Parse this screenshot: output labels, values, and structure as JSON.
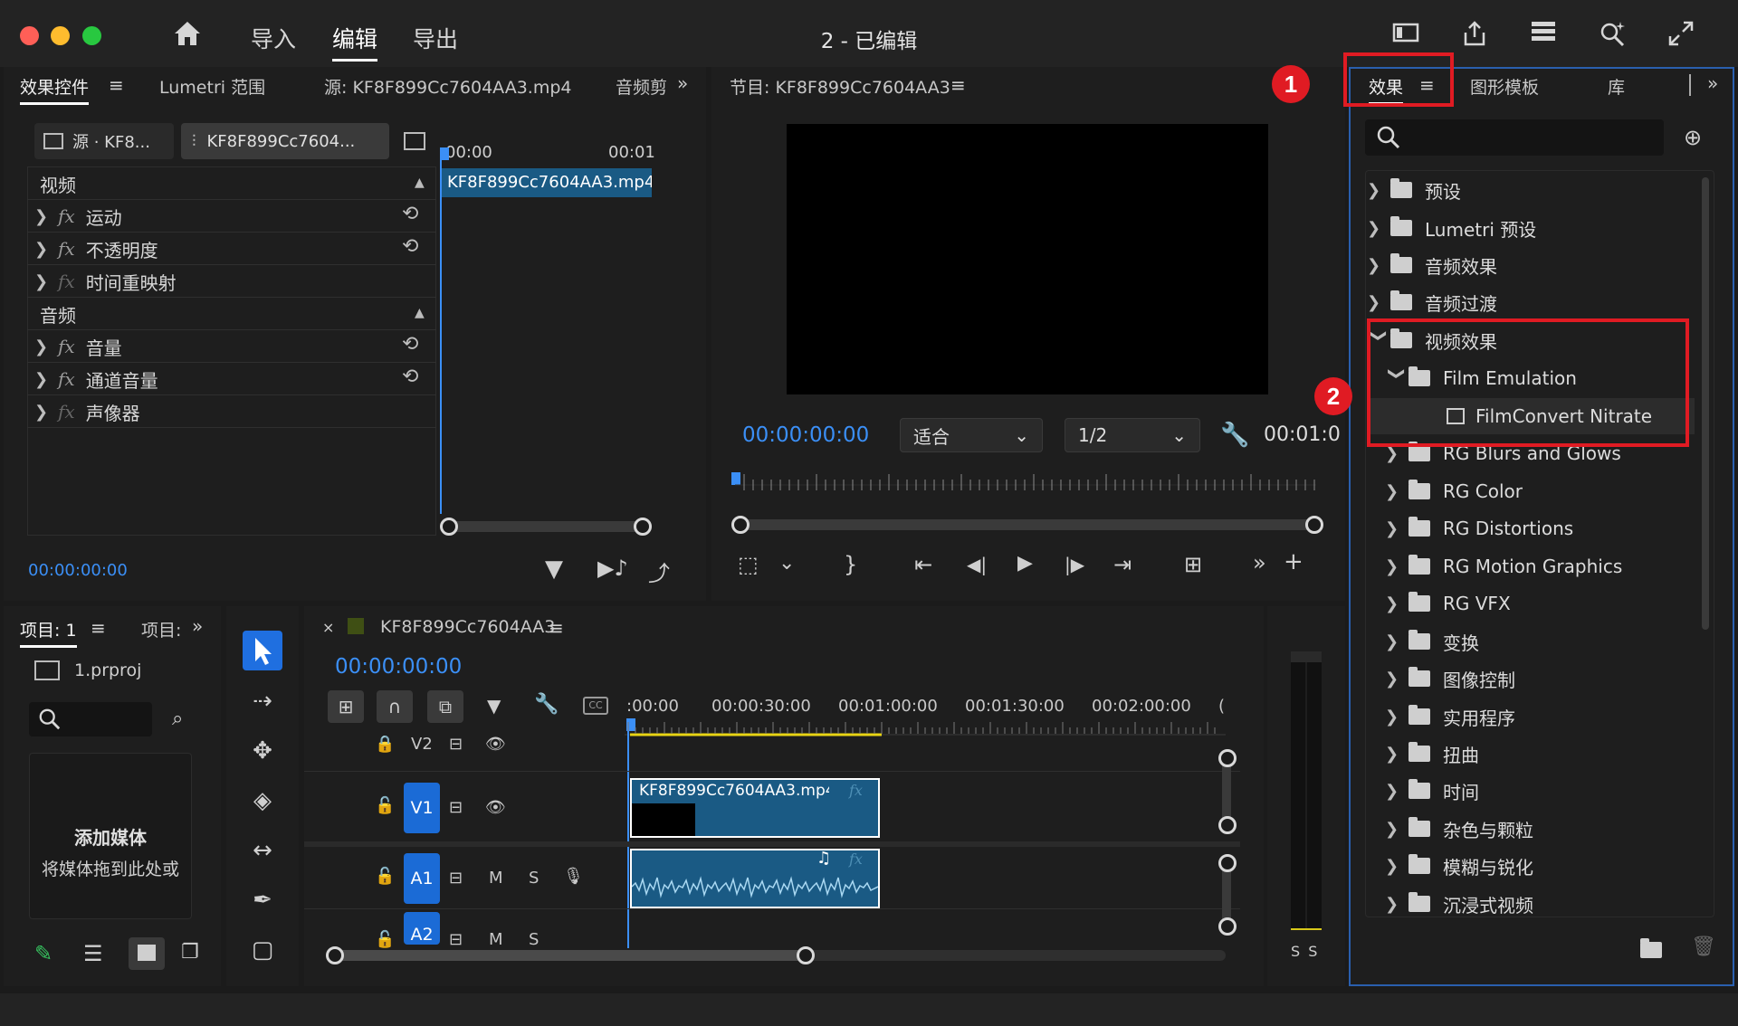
{
  "window": {
    "title": "2 - 已编辑"
  },
  "nav": {
    "import": "导入",
    "edit": "编辑",
    "export": "导出"
  },
  "effect_controls": {
    "tabs": [
      "效果控件",
      "Lumetri 范围",
      "源: KF8F899Cc7604AA3.mp4",
      "音频剪"
    ],
    "source_btn": "源 · KF8...",
    "seq_btn": "KF8F899Cc7604...",
    "time_start": "00:00",
    "time_end": "00:01",
    "clip_label": "KF8F899Cc7604AA3.mp4",
    "video_header": "视频",
    "audio_header": "音频",
    "video_rows": [
      "运动",
      "不透明度",
      "时间重映射"
    ],
    "audio_rows": [
      "音量",
      "通道音量",
      "声像器"
    ],
    "timecode": "00:00:00:00"
  },
  "program": {
    "title": "节目: KF8F899Cc7604AA3",
    "timecode": "00:00:00:00",
    "fit": "适合",
    "resolution": "1/2",
    "duration": "00:01:0"
  },
  "project": {
    "tabs": [
      "项目: 1",
      "项目:"
    ],
    "file": "1.prproj",
    "add_media": "添加媒体",
    "drop_hint": "将媒体拖到此处或"
  },
  "timeline": {
    "seq_name": "KF8F899Cc7604AA3",
    "timecode": "00:00:00:00",
    "ruler": [
      ":00:00",
      "00:00:30:00",
      "00:01:00:00",
      "00:01:30:00",
      "00:02:00:00",
      "("
    ],
    "tracks": {
      "v2": "V2",
      "v1": "V1",
      "a1": "A1",
      "a2": "A2",
      "m": "M",
      "s": "S"
    },
    "clip_label": "KF8F899Cc7604AA3.mp4...",
    "meter_labels": "S S"
  },
  "effects": {
    "tabs": [
      "效果",
      "图形模板",
      "库"
    ],
    "tree": [
      {
        "label": "预设",
        "level": 0,
        "open": false
      },
      {
        "label": "Lumetri 预设",
        "level": 0,
        "open": false
      },
      {
        "label": "音频效果",
        "level": 0,
        "open": false
      },
      {
        "label": "音频过渡",
        "level": 0,
        "open": false
      },
      {
        "label": "视频效果",
        "level": 0,
        "open": true
      },
      {
        "label": "Film Emulation",
        "level": 1,
        "open": true
      },
      {
        "label": "FilmConvert Nitrate",
        "level": 2,
        "open": false
      },
      {
        "label": "RG Blurs and Glows",
        "level": 1,
        "open": false
      },
      {
        "label": "RG Color",
        "level": 1,
        "open": false
      },
      {
        "label": "RG Distortions",
        "level": 1,
        "open": false
      },
      {
        "label": "RG Motion Graphics",
        "level": 1,
        "open": false
      },
      {
        "label": "RG VFX",
        "level": 1,
        "open": false
      },
      {
        "label": "变换",
        "level": 1,
        "open": false
      },
      {
        "label": "图像控制",
        "level": 1,
        "open": false
      },
      {
        "label": "实用程序",
        "level": 1,
        "open": false
      },
      {
        "label": "扭曲",
        "level": 1,
        "open": false
      },
      {
        "label": "时间",
        "level": 1,
        "open": false
      },
      {
        "label": "杂色与颗粒",
        "level": 1,
        "open": false
      },
      {
        "label": "模糊与锐化",
        "level": 1,
        "open": false
      },
      {
        "label": "沉浸式视频",
        "level": 1,
        "open": false
      }
    ]
  },
  "annotations": {
    "one": "1",
    "two": "2"
  },
  "colors": {
    "accent_blue": "#3b8ff6",
    "track_blue": "#1b6bd6",
    "clip_blue": "#1a5a84",
    "annotation_red": "#e01b23"
  }
}
